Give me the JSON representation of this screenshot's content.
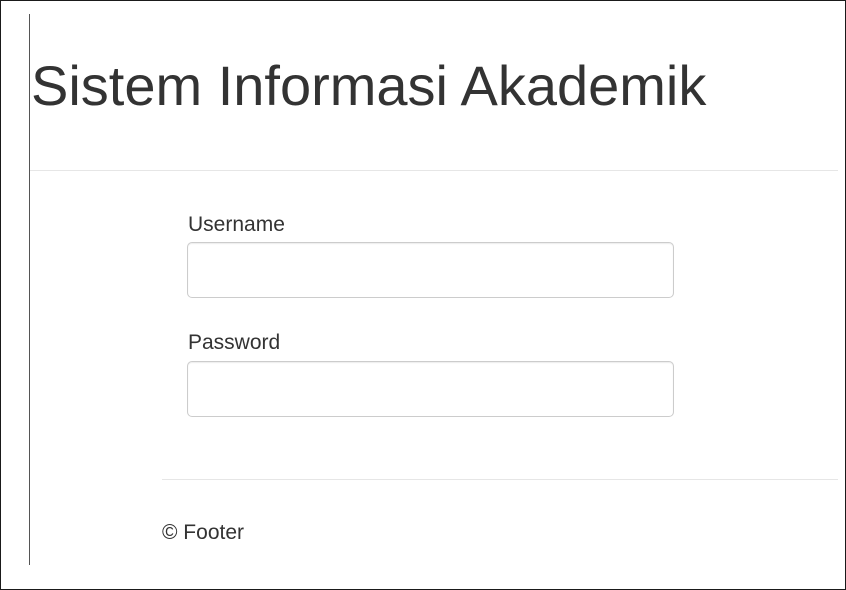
{
  "header": {
    "title": "Sistem Informasi Akademik"
  },
  "login_form": {
    "username": {
      "label": "Username",
      "value": "",
      "placeholder": ""
    },
    "password": {
      "label": "Password",
      "value": "",
      "placeholder": ""
    }
  },
  "footer": {
    "text": "© Footer"
  },
  "colors": {
    "text": "#333333",
    "input_border": "#cccccc",
    "divider": "#e6e6e6"
  }
}
